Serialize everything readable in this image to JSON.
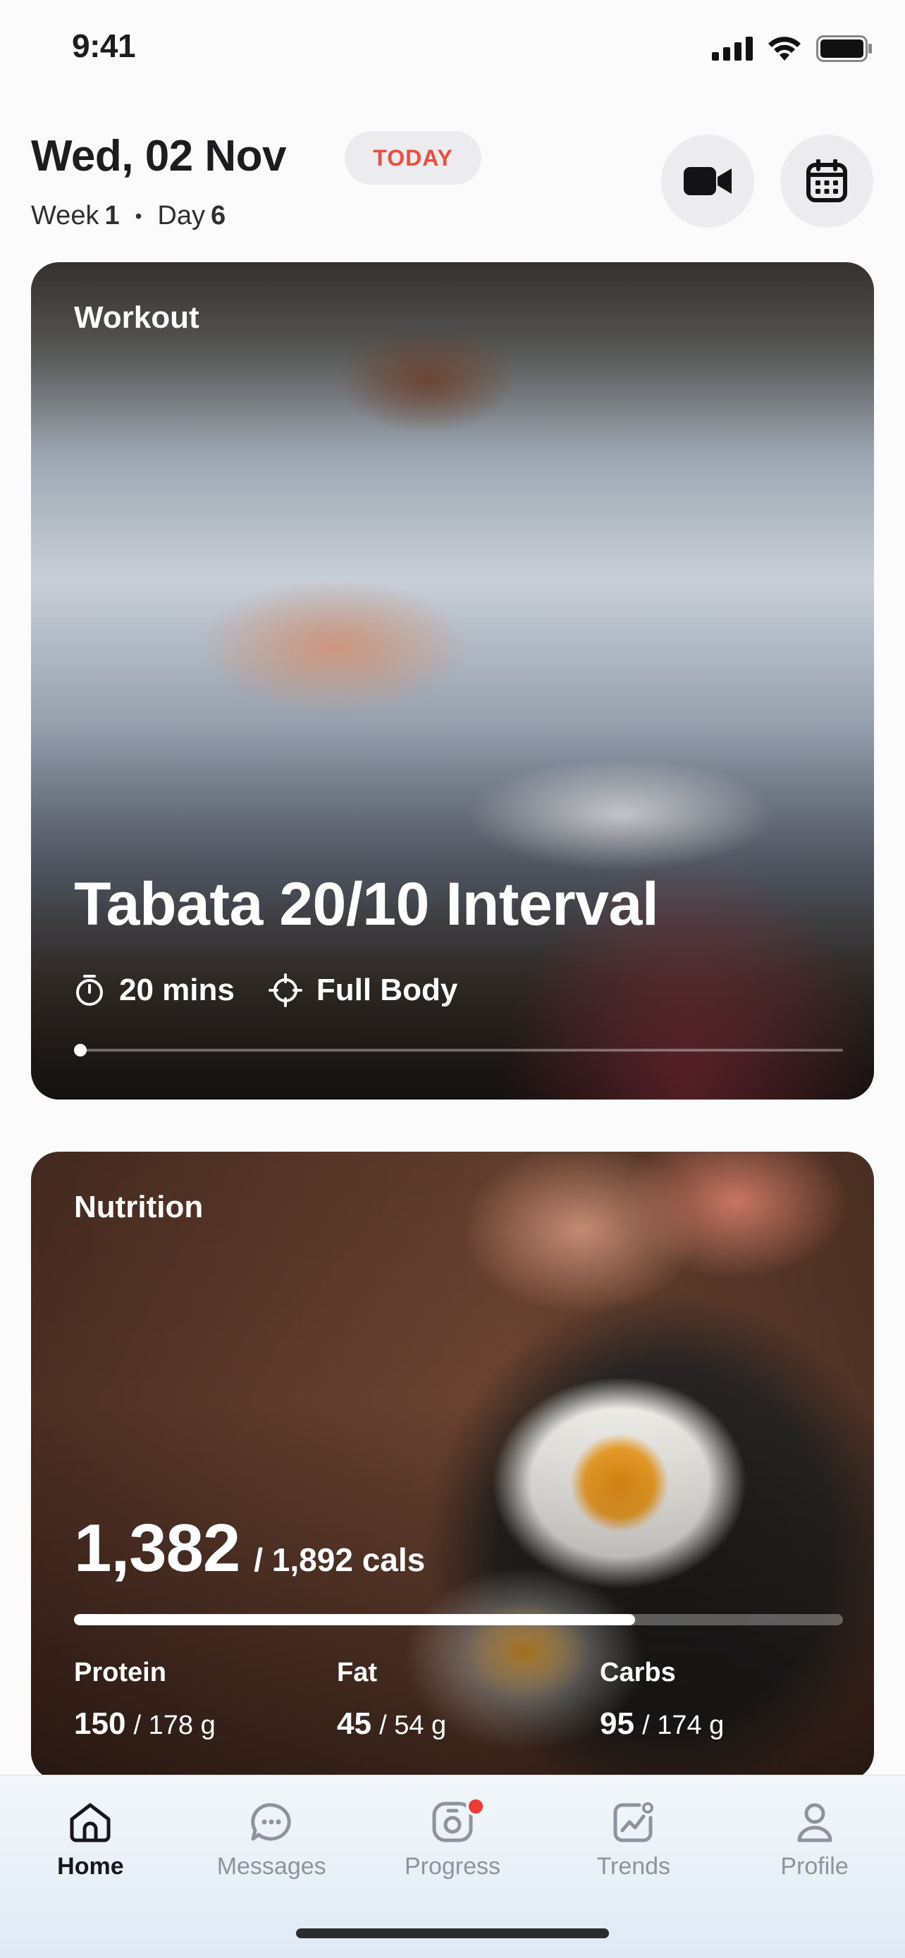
{
  "status_bar": {
    "time": "9:41"
  },
  "header": {
    "date": "Wed, 02 Nov",
    "today_badge": "TODAY",
    "week_label": "Week",
    "week_number": "1",
    "day_label": "Day",
    "day_number": "6",
    "separator": "•"
  },
  "workout": {
    "label": "Workout",
    "title": "Tabata 20/10 Interval",
    "duration": "20 mins",
    "focus": "Full Body",
    "progress": 0
  },
  "nutrition": {
    "label": "Nutrition",
    "consumed": "1,382",
    "target": "/ 1,892 cals",
    "progress": 0.73,
    "macros": [
      {
        "label": "Protein",
        "value": "150",
        "target": "/ 178 g"
      },
      {
        "label": "Fat",
        "value": "45",
        "target": "/ 54 g"
      },
      {
        "label": "Carbs",
        "value": "95",
        "target": "/ 174 g"
      }
    ]
  },
  "tabs": [
    {
      "label": "Home",
      "icon": "home-icon",
      "active": true
    },
    {
      "label": "Messages",
      "icon": "messages-icon",
      "active": false
    },
    {
      "label": "Progress",
      "icon": "progress-icon",
      "active": false,
      "badge": true
    },
    {
      "label": "Trends",
      "icon": "trends-icon",
      "active": false
    },
    {
      "label": "Profile",
      "icon": "profile-icon",
      "active": false
    }
  ],
  "colors": {
    "accent_red": "#ef4b3f",
    "notify_dot": "#ef3b35"
  }
}
